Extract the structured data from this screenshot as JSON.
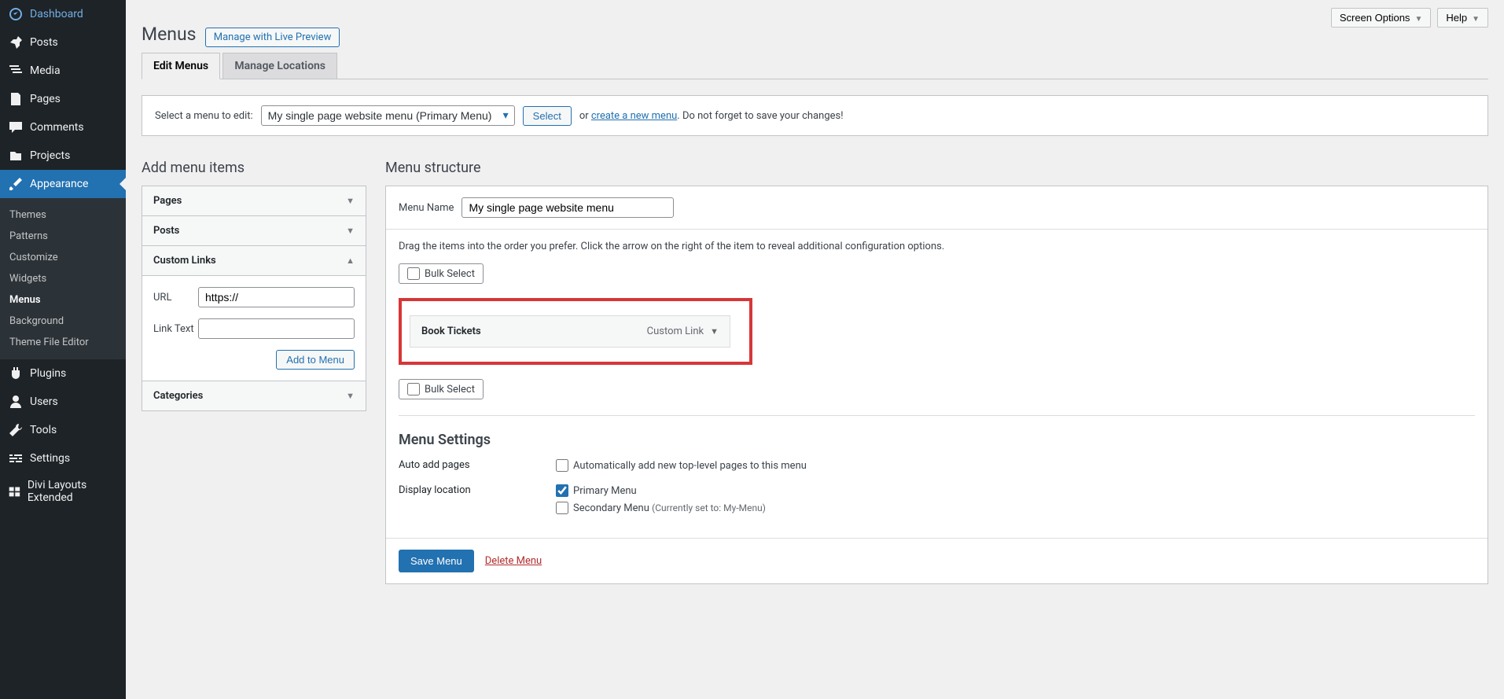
{
  "top": {
    "screen_options": "Screen Options",
    "help": "Help"
  },
  "sidebar": {
    "items": [
      {
        "label": "Dashboard"
      },
      {
        "label": "Posts"
      },
      {
        "label": "Media"
      },
      {
        "label": "Pages"
      },
      {
        "label": "Comments"
      },
      {
        "label": "Projects"
      },
      {
        "label": "Appearance"
      },
      {
        "label": "Plugins"
      },
      {
        "label": "Users"
      },
      {
        "label": "Tools"
      },
      {
        "label": "Settings"
      },
      {
        "label": "Divi Layouts Extended"
      }
    ],
    "submenu": [
      {
        "label": "Themes"
      },
      {
        "label": "Patterns"
      },
      {
        "label": "Customize"
      },
      {
        "label": "Widgets"
      },
      {
        "label": "Menus"
      },
      {
        "label": "Background"
      },
      {
        "label": "Theme File Editor"
      }
    ]
  },
  "page": {
    "title": "Menus",
    "title_action": "Manage with Live Preview",
    "tabs": [
      {
        "label": "Edit Menus"
      },
      {
        "label": "Manage Locations"
      }
    ]
  },
  "manage": {
    "prefix": "Select a menu to edit:",
    "selected_menu": "My single page website menu (Primary Menu)",
    "select_btn": "Select",
    "or_text": "or ",
    "create_link": "create a new menu",
    "suffix": ". Do not forget to save your changes!"
  },
  "left_col": {
    "heading": "Add menu items",
    "accordion": {
      "pages": "Pages",
      "posts": "Posts",
      "custom_links": "Custom Links",
      "categories": "Categories",
      "url_label": "URL",
      "url_value": "https://",
      "linktext_label": "Link Text",
      "linktext_value": "",
      "add_btn": "Add to Menu"
    }
  },
  "right_col": {
    "heading": "Menu structure",
    "menu_name_label": "Menu Name",
    "menu_name_value": "My single page website menu",
    "instructions": "Drag the items into the order you prefer. Click the arrow on the right of the item to reveal additional configuration options.",
    "bulk_select": "Bulk Select",
    "menu_item": {
      "title": "Book Tickets",
      "type": "Custom Link"
    },
    "settings": {
      "heading": "Menu Settings",
      "auto_label": "Auto add pages",
      "auto_checkbox": "Automatically add new top-level pages to this menu",
      "display_label": "Display location",
      "primary": "Primary Menu",
      "secondary": "Secondary Menu ",
      "secondary_note": "(Currently set to: My-Menu)"
    },
    "save_btn": "Save Menu",
    "delete_link": "Delete Menu"
  }
}
